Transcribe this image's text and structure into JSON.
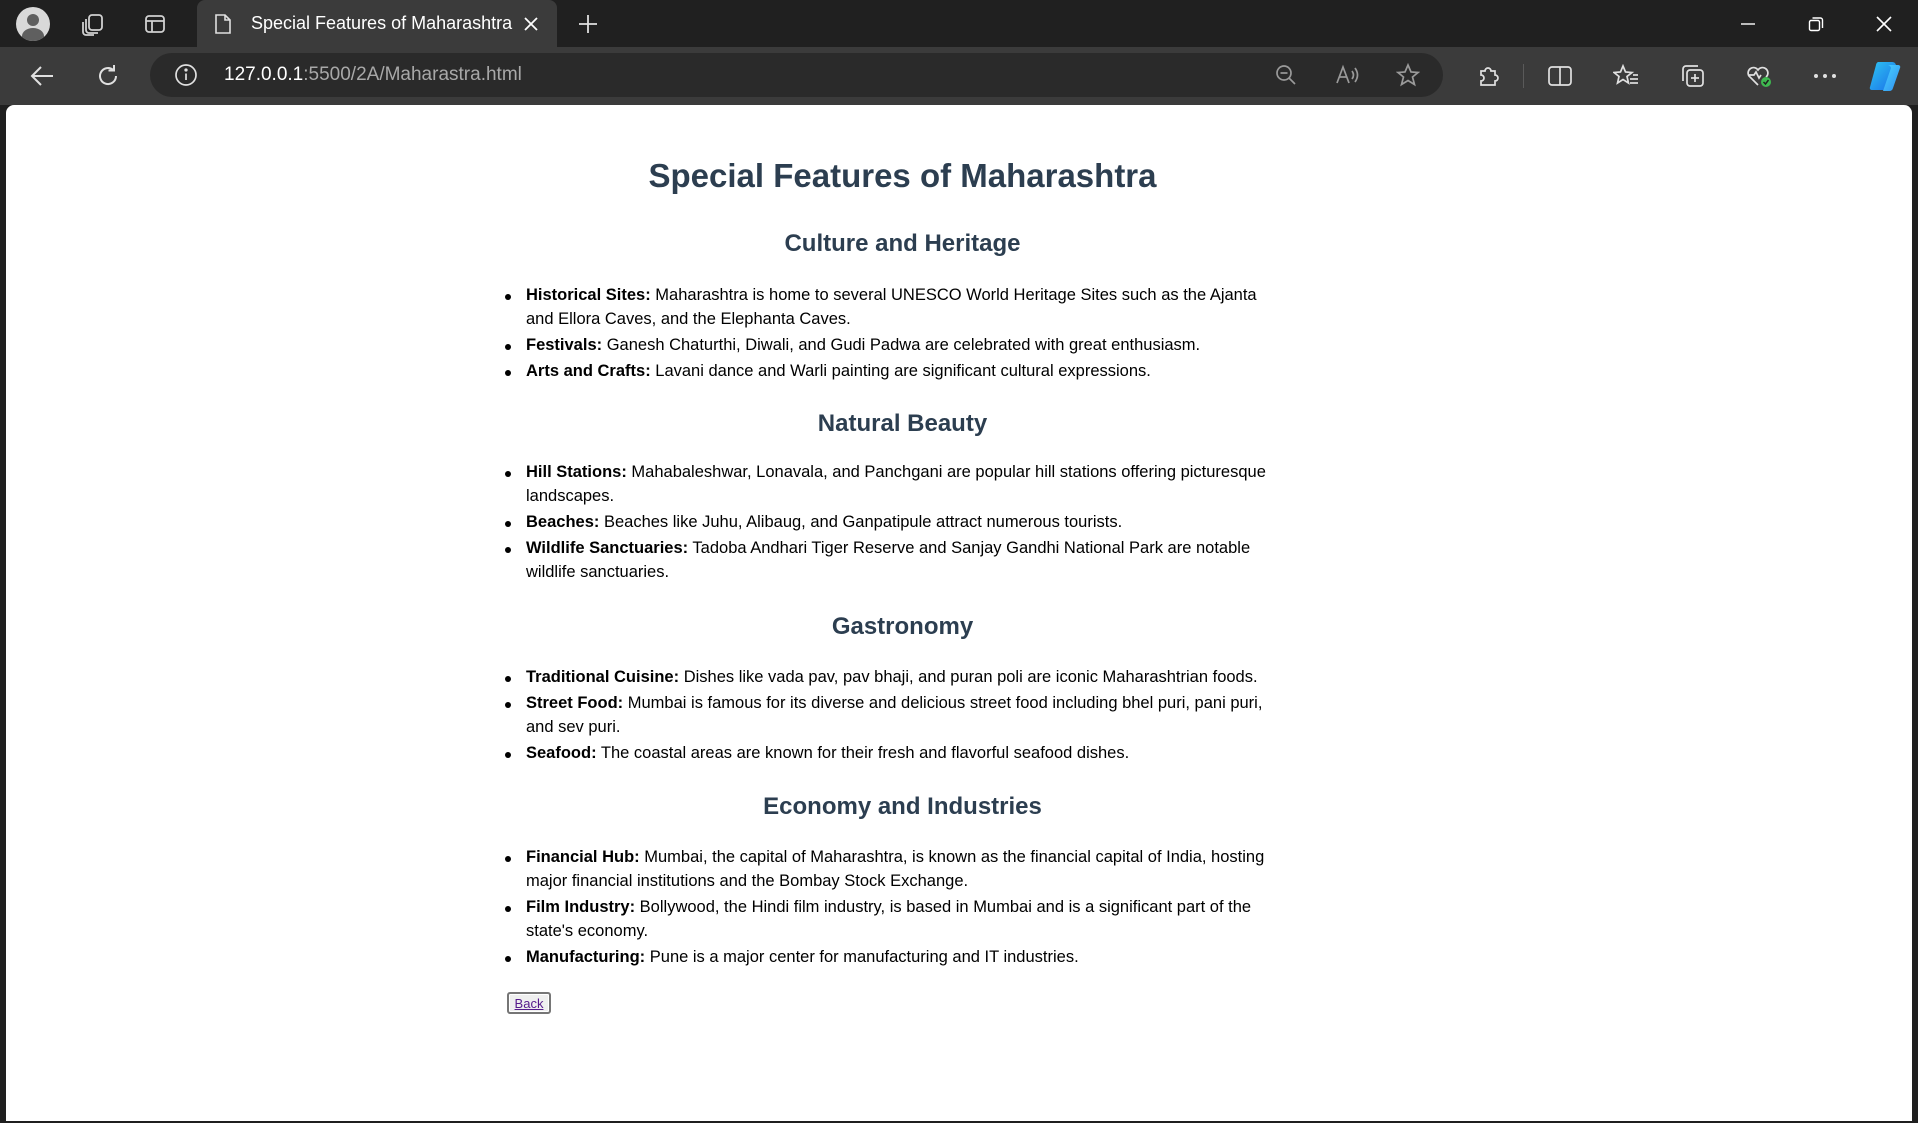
{
  "browser": {
    "tab_title": "Special Features of Maharashtra",
    "url_host": "127.0.0.1",
    "url_path": ":5500/2A/Maharastra.html"
  },
  "page": {
    "title": "Special Features of Maharashtra",
    "sections": [
      {
        "heading": "Culture and Heritage",
        "items": [
          {
            "label": "Historical Sites:",
            "text": " Maharashtra is home to several UNESCO World Heritage Sites such as the Ajanta and Ellora Caves, and the Elephanta Caves."
          },
          {
            "label": "Festivals:",
            "text": " Ganesh Chaturthi, Diwali, and Gudi Padwa are celebrated with great enthusiasm."
          },
          {
            "label": "Arts and Crafts:",
            "text": " Lavani dance and Warli painting are significant cultural expressions."
          }
        ]
      },
      {
        "heading": "Natural Beauty",
        "items": [
          {
            "label": "Hill Stations:",
            "text": " Mahabaleshwar, Lonavala, and Panchgani are popular hill stations offering picturesque landscapes."
          },
          {
            "label": "Beaches:",
            "text": " Beaches like Juhu, Alibaug, and Ganpatipule attract numerous tourists."
          },
          {
            "label": "Wildlife Sanctuaries:",
            "text": " Tadoba Andhari Tiger Reserve and Sanjay Gandhi National Park are notable wildlife sanctuaries."
          }
        ]
      },
      {
        "heading": "Gastronomy",
        "items": [
          {
            "label": "Traditional Cuisine:",
            "text": " Dishes like vada pav, pav bhaji, and puran poli are iconic Maharashtrian foods."
          },
          {
            "label": "Street Food:",
            "text": " Mumbai is famous for its diverse and delicious street food including bhel puri, pani puri, and sev puri."
          },
          {
            "label": "Seafood:",
            "text": " The coastal areas are known for their fresh and flavorful seafood dishes."
          }
        ]
      },
      {
        "heading": "Economy and Industries",
        "items": [
          {
            "label": "Financial Hub:",
            "text": " Mumbai, the capital of Maharashtra, is known as the financial capital of India, hosting major financial institutions and the Bombay Stock Exchange."
          },
          {
            "label": "Film Industry:",
            "text": " Bollywood, the Hindi film industry, is based in Mumbai and is a significant part of the state's economy."
          },
          {
            "label": "Manufacturing:",
            "text": " Pune is a major center for manufacturing and IT industries."
          }
        ]
      }
    ],
    "back_label": "Back"
  }
}
